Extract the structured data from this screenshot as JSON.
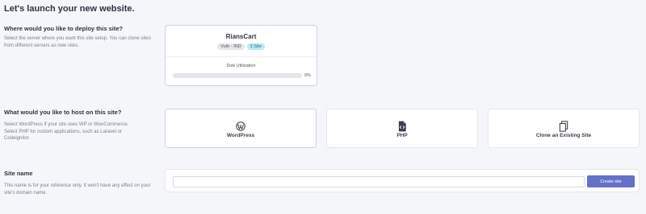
{
  "page": {
    "title": "Let's launch your new website."
  },
  "deploy": {
    "title": "Where would you like to deploy this site?",
    "description": "Select the server where you want this site setup. You can clone sites from different servers as new sites.",
    "server": {
      "name": "RiansCart",
      "provider_tag": "Vultr - IND",
      "sites_tag": "1 Site",
      "disk_label": "Disk Utilization",
      "disk_percent_text": "0%",
      "disk_percent": 0
    }
  },
  "host": {
    "title": "What would you like to host on this site?",
    "description": "Select WordPress if your site uses WP or WooCommerce. Select PHP for custom applications, such as Laravel or Codeignitor.",
    "options": [
      {
        "label": "WordPress",
        "icon": "wordpress-icon"
      },
      {
        "label": "PHP",
        "icon": "php-file-icon"
      },
      {
        "label": "Clone an Existing Site",
        "icon": "copy-icon"
      }
    ]
  },
  "site_name": {
    "title": "Site name",
    "description": "This name is for your reference only. It won't have any effect on your site's domain name.",
    "input_value": "",
    "input_placeholder": "",
    "button_label": "Create site"
  },
  "colors": {
    "accent": "#6670c9",
    "tag_sites": "#b6e9f3",
    "background": "#f5f6fa"
  }
}
